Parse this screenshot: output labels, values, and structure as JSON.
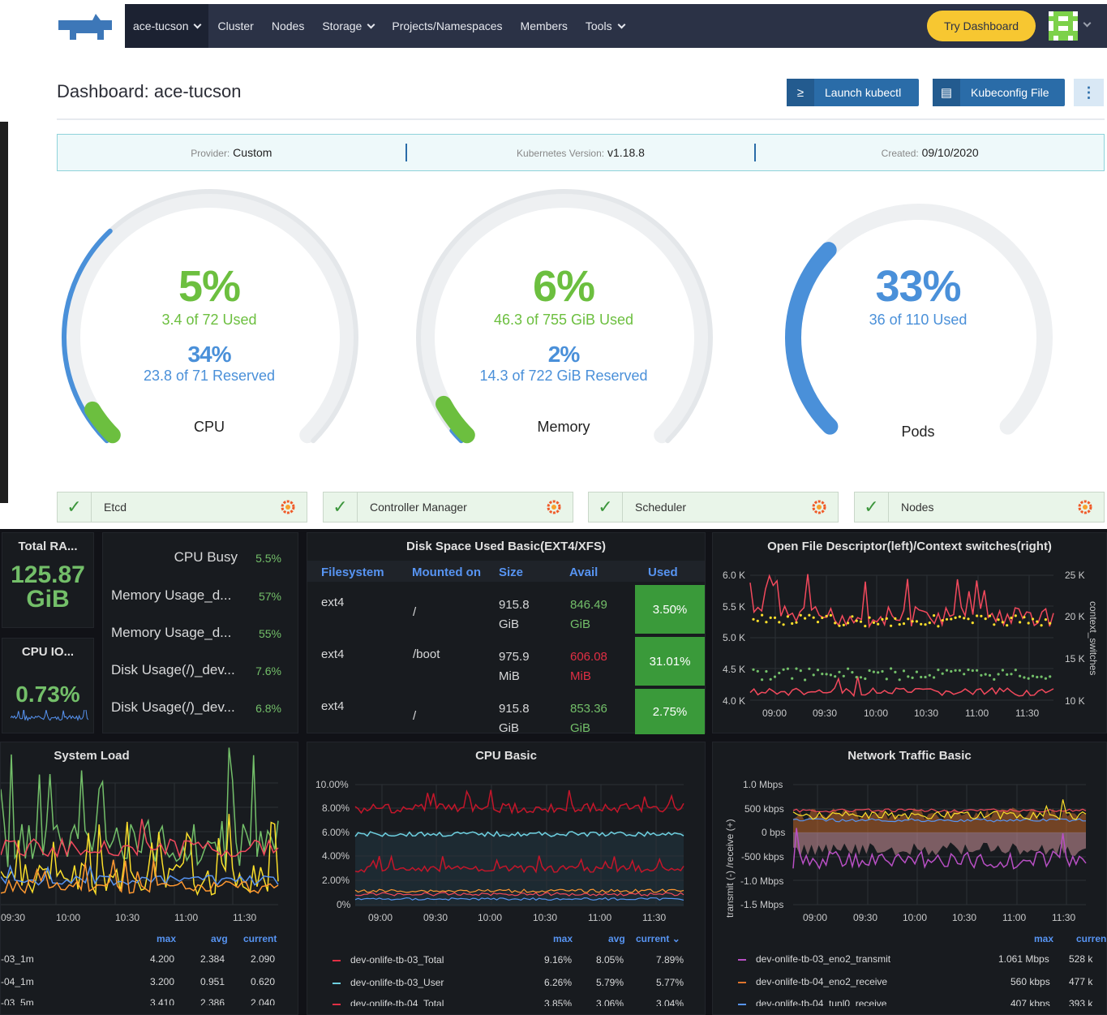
{
  "nav": {
    "cluster_name": "ace-tucson",
    "items": [
      "Cluster",
      "Nodes",
      "Storage",
      "Projects/Namespaces",
      "Members",
      "Tools"
    ],
    "try_dashboard": "Try Dashboard"
  },
  "header": {
    "title": "Dashboard: ace-tucson",
    "launch_kubectl": "Launch kubectl",
    "kubeconfig": "Kubeconfig File"
  },
  "info": {
    "provider_label": "Provider:",
    "provider": "Custom",
    "k8s_label": "Kubernetes Version:",
    "k8s": "v1.18.8",
    "created_label": "Created:",
    "created": "09/10/2020"
  },
  "gauges": {
    "cpu": {
      "pct": "5%",
      "used": "3.4  of  72  Used",
      "res_pct": "34%",
      "reserved": "23.8  of  71  Reserved",
      "label": "CPU",
      "used_fraction": 0.05,
      "reserved_fraction": 0.34
    },
    "memory": {
      "pct": "6%",
      "used": "46.3  of  755  GiB  Used",
      "res_pct": "2%",
      "reserved": "14.3  of  722  GiB  Reserved",
      "label": "Memory",
      "used_fraction": 0.06,
      "reserved_fraction": 0.02
    },
    "pods": {
      "pct": "33%",
      "used": "36  of  110  Used",
      "label": "Pods",
      "used_fraction": 0.33
    }
  },
  "components": [
    "Etcd",
    "Controller Manager",
    "Scheduler",
    "Nodes"
  ],
  "grafana": {
    "total_ram_title": "Total RA...",
    "total_ram_value": "125.87",
    "total_ram_unit": "GiB",
    "cpu_io_title": "CPU IO...",
    "cpu_io_value": "0.73%",
    "bars": [
      {
        "label": "CPU Busy",
        "value": "5.5%"
      },
      {
        "label": "Memory Usage_d...",
        "value": "57%"
      },
      {
        "label": "Memory Usage_d...",
        "value": "55%"
      },
      {
        "label": "Disk Usage(/)_dev...",
        "value": "7.6%"
      },
      {
        "label": "Disk Usage(/)_dev...",
        "value": "6.8%"
      }
    ],
    "disk": {
      "title": "Disk Space Used Basic(EXT4/XFS)",
      "headers": [
        "Filesystem",
        "Mounted on",
        "Size",
        "Avail",
        "Used"
      ],
      "rows": [
        {
          "fs": "ext4",
          "mount": "/",
          "size1": "915.8",
          "size2": "GiB",
          "avail1": "846.49",
          "avail2": "GiB",
          "used": "3.50%"
        },
        {
          "fs": "ext4",
          "mount": "/boot",
          "size1": "975.9",
          "size2": "MiB",
          "avail1": "606.08",
          "avail2": "MiB",
          "used": "31.01%"
        },
        {
          "fs": "ext4",
          "mount": "/",
          "size1": "915.8",
          "size2": "GiB",
          "avail1": "853.36",
          "avail2": "GiB",
          "used": "2.75%"
        }
      ]
    },
    "ofd": {
      "title": "Open File Descriptor(left)/Context switches(right)",
      "left_ticks": [
        "6.0 K",
        "5.5 K",
        "5.0 K",
        "4.5 K",
        "4.0 K"
      ],
      "right_ticks": [
        "25 K",
        "20 K",
        "15 K",
        "10 K"
      ],
      "right_label": "context_switches",
      "x_ticks": [
        "09:00",
        "09:30",
        "10:00",
        "10:30",
        "11:00",
        "11:30"
      ]
    },
    "sysload": {
      "title": "System Load",
      "x_ticks": [
        "09:30",
        "10:00",
        "10:30",
        "11:00",
        "11:30"
      ],
      "cols": [
        "max",
        "avg",
        "current"
      ],
      "rows": [
        {
          "name": "-03_1m",
          "max": "4.200",
          "avg": "2.384",
          "cur": "2.090"
        },
        {
          "name": "-04_1m",
          "max": "3.200",
          "avg": "0.951",
          "cur": "0.620"
        },
        {
          "name": "-03_5m",
          "max": "3.410",
          "avg": "2.386",
          "cur": "2.040"
        }
      ]
    },
    "cpubasic": {
      "title": "CPU Basic",
      "y_ticks": [
        "10.00%",
        "8.00%",
        "6.00%",
        "4.00%",
        "2.00%",
        "0%"
      ],
      "x_ticks": [
        "09:00",
        "09:30",
        "10:00",
        "10:30",
        "11:00",
        "11:30"
      ],
      "cols": [
        "max",
        "avg",
        "current"
      ],
      "rows": [
        {
          "name": "dev-onlife-tb-03_Total",
          "max": "9.16%",
          "avg": "8.05%",
          "cur": "7.89%",
          "color": "#e02f44"
        },
        {
          "name": "dev-onlife-tb-03_User",
          "max": "6.26%",
          "avg": "5.79%",
          "cur": "5.77%",
          "color": "#6ed0e0"
        },
        {
          "name": "dev-onlife-tb-04_Total",
          "max": "3.85%",
          "avg": "3.06%",
          "cur": "3.04%",
          "color": "#e02f44"
        }
      ]
    },
    "net": {
      "title": "Network Traffic Basic",
      "y_label": "transmit (-) /receive (+)",
      "y_ticks": [
        "1.0 Mbps",
        "500 kbps",
        "0 bps",
        "-500 kbps",
        "-1.0 Mbps",
        "-1.5 Mbps"
      ],
      "x_ticks": [
        "09:00",
        "09:30",
        "10:00",
        "10:30",
        "11:00",
        "11:30"
      ],
      "cols": [
        "max",
        "curren"
      ],
      "rows": [
        {
          "name": "dev-onlife-tb-03_eno2_transmit",
          "max": "1.061 Mbps",
          "cur": "528 k",
          "color": "#b84fc4"
        },
        {
          "name": "dev-onlife-tb-04_eno2_receive",
          "max": "560 kbps",
          "cur": "477 k",
          "color": "#e0752d"
        },
        {
          "name": "dev-onlife-tb-04_tunl0_receive",
          "max": "407 kbps",
          "cur": "393 k",
          "color": "#5794f2"
        }
      ]
    }
  }
}
